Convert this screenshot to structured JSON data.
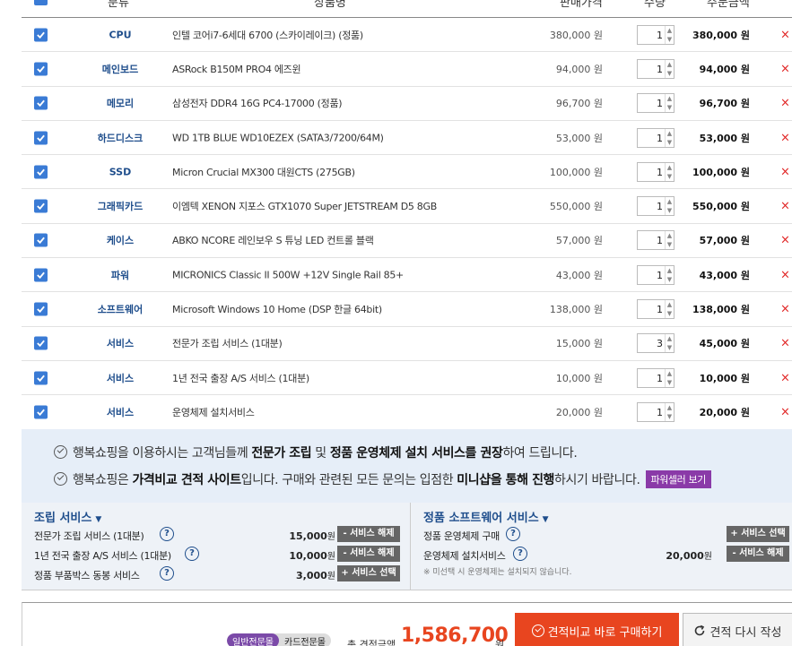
{
  "header": {
    "col_category": "분류",
    "col_product": "상품명",
    "col_price": "판매가격",
    "col_qty": "수량",
    "col_amount": "주문금액"
  },
  "rows": [
    {
      "category": "CPU",
      "product": "인텔 코어i7-6세대 6700 (스카이레이크) (정품)",
      "price": "380,000 원",
      "qty": "1",
      "amount": "380,000 원"
    },
    {
      "category": "메인보드",
      "product": "ASRock B150M PRO4 에즈윈",
      "price": "94,000 원",
      "qty": "1",
      "amount": "94,000 원"
    },
    {
      "category": "메모리",
      "product": "삼성전자 DDR4 16G PC4-17000 (정품)",
      "price": "96,700 원",
      "qty": "1",
      "amount": "96,700 원"
    },
    {
      "category": "하드디스크",
      "product": "WD 1TB BLUE WD10EZEX (SATA3/7200/64M)",
      "price": "53,000 원",
      "qty": "1",
      "amount": "53,000 원"
    },
    {
      "category": "SSD",
      "product": "Micron Crucial MX300 대원CTS (275GB)",
      "price": "100,000 원",
      "qty": "1",
      "amount": "100,000 원"
    },
    {
      "category": "그래픽카드",
      "product": "이엠텍 XENON 지포스 GTX1070 Super JETSTREAM D5 8GB",
      "price": "550,000 원",
      "qty": "1",
      "amount": "550,000 원"
    },
    {
      "category": "케이스",
      "product": "ABKO NCORE 레인보우 S 튜닝 LED 컨트롤 블랙",
      "price": "57,000 원",
      "qty": "1",
      "amount": "57,000 원"
    },
    {
      "category": "파워",
      "product": "MICRONICS Classic II 500W +12V Single Rail 85+",
      "price": "43,000 원",
      "qty": "1",
      "amount": "43,000 원"
    },
    {
      "category": "소프트웨어",
      "product": "Microsoft Windows 10 Home (DSP 한글 64bit)",
      "price": "138,000 원",
      "qty": "1",
      "amount": "138,000 원"
    },
    {
      "category": "서비스",
      "product": "전문가 조립 서비스 (1대분)",
      "price": "15,000 원",
      "qty": "3",
      "amount": "45,000 원"
    },
    {
      "category": "서비스",
      "product": "1년 전국 출장 A/S 서비스 (1대분)",
      "price": "10,000 원",
      "qty": "1",
      "amount": "10,000 원"
    },
    {
      "category": "서비스",
      "product": "운영체제 설치서비스",
      "price": "20,000 원",
      "qty": "1",
      "amount": "20,000 원"
    }
  ],
  "row_delete_glyph": "×",
  "info": {
    "line1_a": "행복쇼핑을 이용하시는 고객님들께 ",
    "line1_b": "전문가 조립",
    "line1_c": " 및 ",
    "line1_d": "정품 운영체제 설치 서비스를 권장",
    "line1_e": "하여 드립니다.",
    "line2_a": "행복쇼핑은 ",
    "line2_b": "가격비교 견적 사이트",
    "line2_c": "입니다. 구매와 관련된 모든 문의는 입점한 ",
    "line2_d": "미니샵을 통해 진행",
    "line2_e": "하시기 바랍니다.",
    "badge": "파워셀러 보기"
  },
  "assembly": {
    "title": "조립 서비스",
    "items": [
      {
        "label": "전문가 조립 서비스 (1대분)",
        "amount": "15,000",
        "unit": "원",
        "button": "- 서비스 해제"
      },
      {
        "label": "1년 전국 출장 A/S 서비스 (1대분)",
        "amount": "10,000",
        "unit": "원",
        "button": "- 서비스 해제"
      },
      {
        "label": "정품 부품박스 동봉 서비스",
        "amount": "3,000",
        "unit": "원",
        "button": "+ 서비스 선택"
      }
    ]
  },
  "software": {
    "title": "정품 소프트웨어 서비스",
    "items": [
      {
        "label": "정품 운영체제 구매",
        "amount": "",
        "unit": "",
        "button": "+ 서비스 선택"
      },
      {
        "label": "운영체제 설치서비스",
        "amount": "20,000",
        "unit": "원",
        "button": "- 서비스 해제"
      }
    ],
    "note": "※ 미선택 시 운영체제는 설치되지 않습니다."
  },
  "bottom": {
    "tab_general": "일반전문몰",
    "tab_card": "카드전문몰",
    "total_label": "총 견적금액",
    "total_value": "1,586,700",
    "total_unit": "원",
    "buy_button": "견적비교 바로 구매하기",
    "redo_button": "견적 다시 작성"
  },
  "colors": {
    "accent_blue": "#3a7bd5",
    "category_text": "#1f4e8c",
    "delete_red": "#e02020",
    "buy_orange": "#e8451f",
    "badge_purple": "#8a3aa8"
  }
}
